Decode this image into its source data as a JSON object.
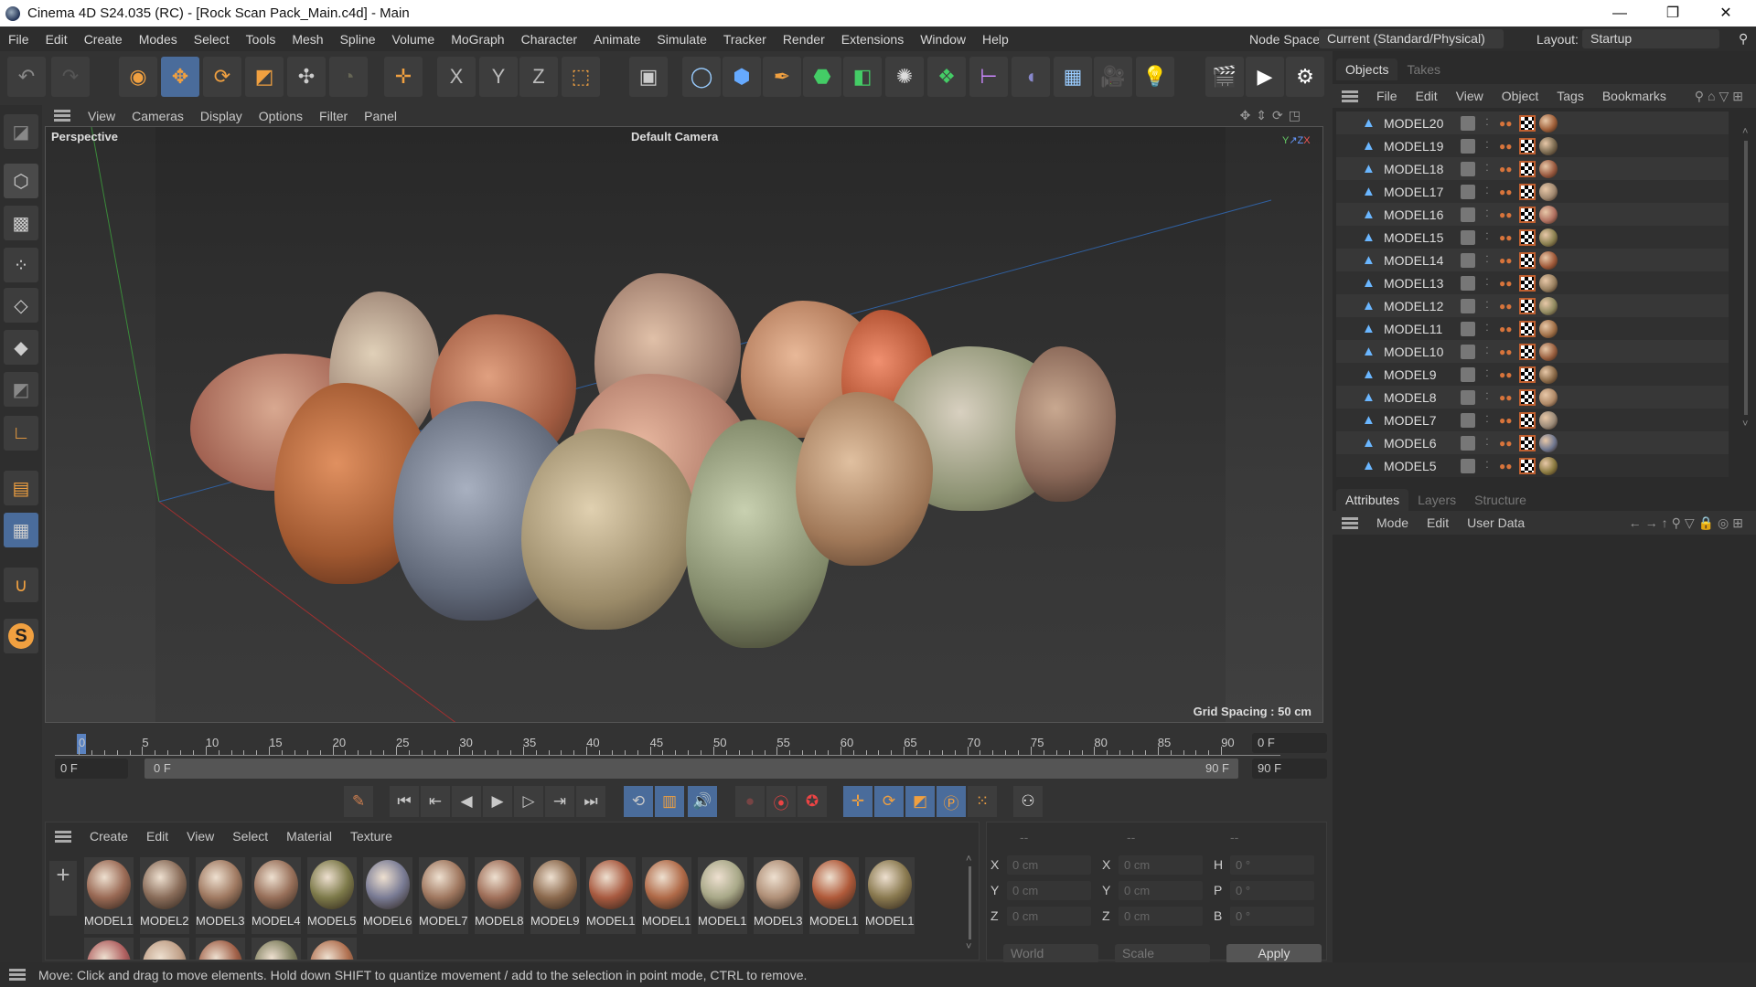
{
  "window": {
    "title": "Cinema 4D S24.035 (RC) - [Rock Scan Pack_Main.c4d] - Main",
    "minimize": "—",
    "maximize": "❐",
    "close": "✕"
  },
  "menu": [
    "File",
    "Edit",
    "Create",
    "Modes",
    "Select",
    "Tools",
    "Mesh",
    "Spline",
    "Volume",
    "MoGraph",
    "Character",
    "Animate",
    "Simulate",
    "Tracker",
    "Render",
    "Extensions",
    "Window",
    "Help"
  ],
  "node_space": {
    "label": "Node Space:",
    "value": "Current (Standard/Physical)"
  },
  "layout": {
    "label": "Layout:",
    "value": "Startup"
  },
  "viewport": {
    "menu": [
      "View",
      "Cameras",
      "Display",
      "Options",
      "Filter",
      "Panel"
    ],
    "view_name": "Perspective",
    "camera": "Default Camera",
    "grid_spacing": "Grid Spacing : 50 cm"
  },
  "objects": {
    "tabs": [
      "Objects",
      "Takes"
    ],
    "menu": [
      "File",
      "Edit",
      "View",
      "Object",
      "Tags",
      "Bookmarks"
    ],
    "items": [
      "MODEL20",
      "MODEL19",
      "MODEL18",
      "MODEL17",
      "MODEL16",
      "MODEL15",
      "MODEL14",
      "MODEL13",
      "MODEL12",
      "MODEL11",
      "MODEL10",
      "MODEL9",
      "MODEL8",
      "MODEL7",
      "MODEL6",
      "MODEL5"
    ]
  },
  "attributes": {
    "tabs": [
      "Attributes",
      "Layers",
      "Structure"
    ],
    "menu": [
      "Mode",
      "Edit",
      "User Data"
    ]
  },
  "timeline": {
    "ticks": [
      "0",
      "5",
      "10",
      "15",
      "20",
      "25",
      "30",
      "35",
      "40",
      "45",
      "50",
      "55",
      "60",
      "65",
      "70",
      "75",
      "80",
      "85",
      "90"
    ],
    "current_frame": "0 F",
    "start": "0 F",
    "range_start": "0 F",
    "range_end": "90 F",
    "end": "90 F"
  },
  "materials": {
    "menu": [
      "Create",
      "Edit",
      "View",
      "Select",
      "Material",
      "Texture"
    ],
    "row1": [
      "MODEL1",
      "MODEL2",
      "MODEL3",
      "MODEL4",
      "MODEL5",
      "MODEL6",
      "MODEL7",
      "MODEL8",
      "MODEL9",
      "MODEL1",
      "MODEL1",
      "MODEL1",
      "MODEL3",
      "MODEL1",
      "MODEL1"
    ],
    "colors": [
      "#9a6a55",
      "#8a6d5a",
      "#a07a62",
      "#98705a",
      "#7d7a4a",
      "#7a7c95",
      "#a07860",
      "#a0705a",
      "#8c6a4e",
      "#a85a40",
      "#b06a48",
      "#a8a888",
      "#b09078",
      "#b05a3a",
      "#8a7a50"
    ],
    "row2_colors": [
      "#b06060",
      "#c0a088",
      "#a06048",
      "#808060",
      "#b07050"
    ]
  },
  "coords": {
    "headers": [
      "--",
      "--",
      "--"
    ],
    "rows": [
      [
        "X",
        "0 cm",
        "X",
        "0 cm",
        "H",
        "0 °"
      ],
      [
        "Y",
        "0 cm",
        "Y",
        "0 cm",
        "P",
        "0 °"
      ],
      [
        "Z",
        "0 cm",
        "Z",
        "0 cm",
        "B",
        "0 °"
      ]
    ],
    "mode1": "World",
    "mode2": "Scale",
    "apply": "Apply"
  },
  "status": "Move: Click and drag to move elements. Hold down SHIFT to quantize movement / add to the selection in point mode, CTRL to remove."
}
